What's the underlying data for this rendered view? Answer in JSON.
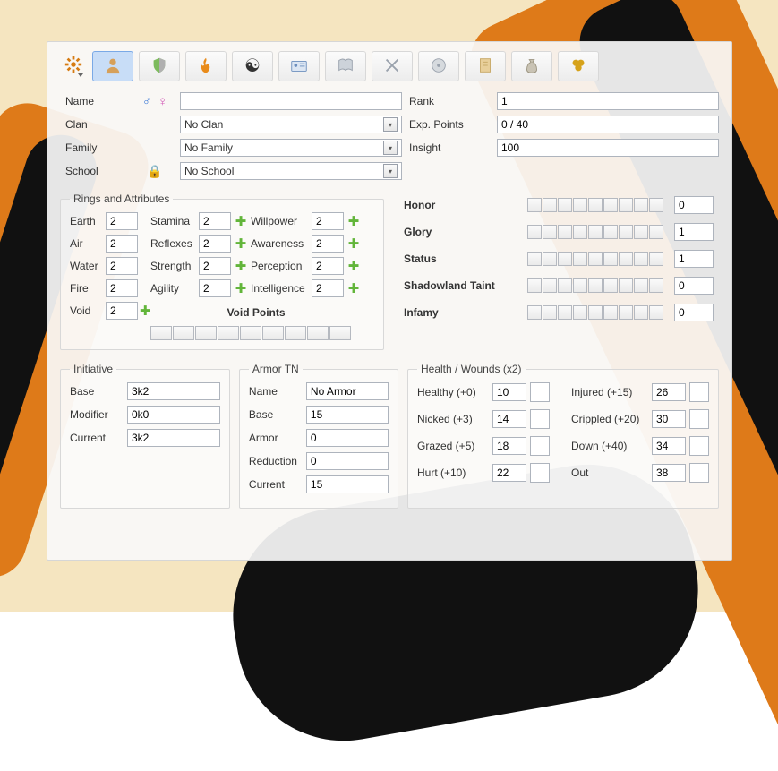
{
  "toolbar": {
    "settings": "settings",
    "character": "character",
    "skills": "skills",
    "fire": "fire",
    "void": "void",
    "id": "id",
    "book": "book",
    "weapons": "weapons",
    "disc": "disc",
    "notes": "notes",
    "money": "money",
    "rings": "rings"
  },
  "identity": {
    "name_label": "Name",
    "name": "",
    "rank_label": "Rank",
    "rank": "1",
    "clan_label": "Clan",
    "clan": "No Clan",
    "exp_label": "Exp. Points",
    "exp": "0 / 40",
    "family_label": "Family",
    "family": "No Family",
    "insight_label": "Insight",
    "insight": "100",
    "school_label": "School",
    "school": "No School"
  },
  "rings_title": "Rings and Attributes",
  "rings": {
    "earth_label": "Earth",
    "earth": "2",
    "air_label": "Air",
    "air": "2",
    "water_label": "Water",
    "water": "2",
    "fire_label": "Fire",
    "fire": "2",
    "void_label": "Void",
    "void": "2",
    "stamina_label": "Stamina",
    "stamina": "2",
    "reflexes_label": "Reflexes",
    "reflexes": "2",
    "strength_label": "Strength",
    "strength": "2",
    "agility_label": "Agility",
    "agility": "2",
    "willpower_label": "Willpower",
    "willpower": "2",
    "awareness_label": "Awareness",
    "awareness": "2",
    "perception_label": "Perception",
    "perception": "2",
    "intelligence_label": "Intelligence",
    "intelligence": "2",
    "void_points_label": "Void Points"
  },
  "social": {
    "honor_label": "Honor",
    "honor": "0",
    "glory_label": "Glory",
    "glory": "1",
    "status_label": "Status",
    "status": "1",
    "taint_label": "Shadowland Taint",
    "taint": "0",
    "infamy_label": "Infamy",
    "infamy": "0"
  },
  "initiative": {
    "title": "Initiative",
    "base_label": "Base",
    "base": "3k2",
    "modifier_label": "Modifier",
    "modifier": "0k0",
    "current_label": "Current",
    "current": "3k2"
  },
  "armor": {
    "title": "Armor TN",
    "name_label": "Name",
    "name": "No Armor",
    "base_label": "Base",
    "base": "15",
    "armor_label": "Armor",
    "armor": "0",
    "reduction_label": "Reduction",
    "reduction": "0",
    "current_label": "Current",
    "current": "15"
  },
  "health": {
    "title": "Health / Wounds (x2)",
    "healthy_label": "Healthy (+0)",
    "healthy": "10",
    "nicked_label": "Nicked (+3)",
    "nicked": "14",
    "grazed_label": "Grazed (+5)",
    "grazed": "18",
    "hurt_label": "Hurt (+10)",
    "hurt": "22",
    "injured_label": "Injured (+15)",
    "injured": "26",
    "crippled_label": "Crippled (+20)",
    "crippled": "30",
    "down_label": "Down (+40)",
    "down": "34",
    "out_label": "Out",
    "out": "38"
  }
}
